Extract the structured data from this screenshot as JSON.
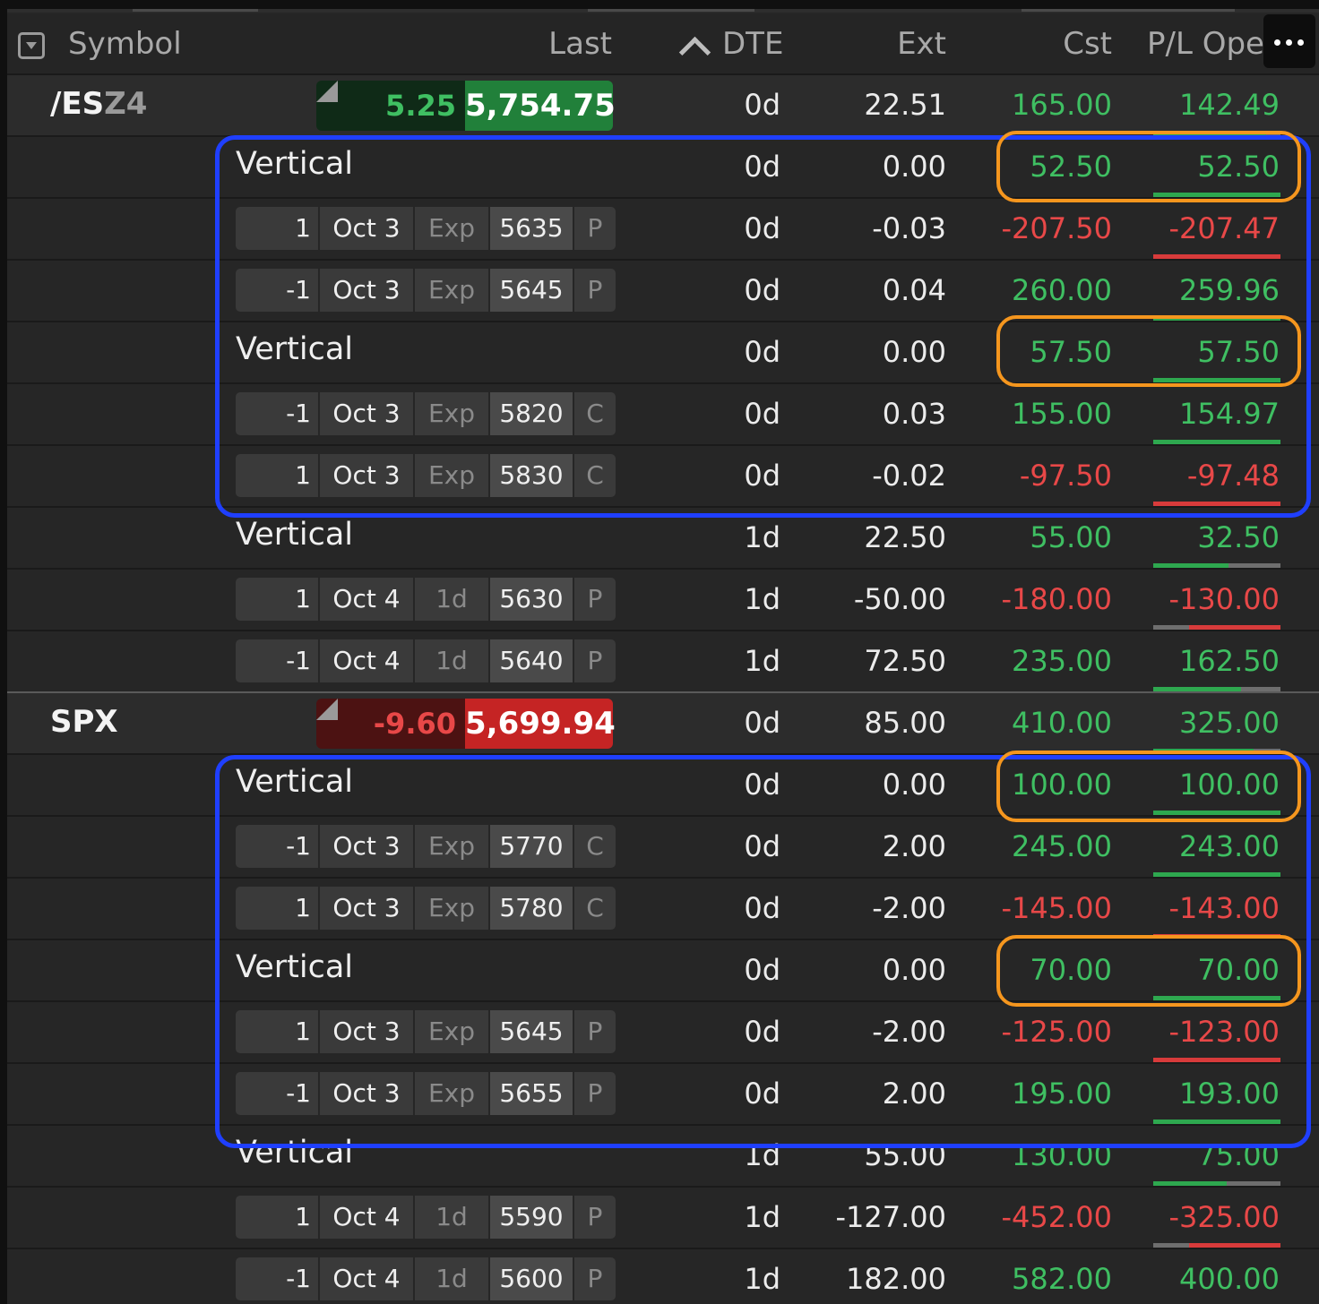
{
  "header": {
    "symbol": "Symbol",
    "last": "Last",
    "dte": "DTE",
    "ext": "Ext",
    "cst": "Cst",
    "pl": "P/L Open",
    "menu_icon": "ellipsis-icon",
    "sort_icon": "chevron-up-icon",
    "dropdown_icon": "dropdown-square-icon"
  },
  "colors": {
    "positive": "#3fbf62",
    "negative": "#e84848",
    "annotation_blue": "#1f3fff",
    "annotation_orange": "#f5961e"
  },
  "groups": [
    {
      "symbol_main": "/ES",
      "symbol_suffix": "Z4",
      "change": "5.25",
      "last": "5,754.75",
      "dte": "0d",
      "ext": "22.51",
      "cst": "165.00",
      "pl": "142.49",
      "pl_green_fraction": 0.89,
      "pl_red_fraction": 0
    },
    {
      "symbol_main": "SPX",
      "symbol_suffix": "",
      "change": "-9.60",
      "last": "5,699.94",
      "dte": "0d",
      "ext": "85.00",
      "cst": "410.00",
      "pl": "325.00",
      "pl_green_fraction": 0.79,
      "pl_red_fraction": 0
    }
  ],
  "rows": [
    {
      "kind": "strategy",
      "label": "Vertical",
      "dte": "0d",
      "ext": "0.00",
      "cst": "52.50",
      "pl": "52.50",
      "pl_green_fraction": 1.0,
      "pl_red_fraction": 0
    },
    {
      "kind": "leg",
      "qty": "1",
      "exp": "Oct 3",
      "dte_tag": "Exp",
      "strike": "5635",
      "type": "P",
      "dte": "0d",
      "ext": "-0.03",
      "cst": "-207.50",
      "pl": "-207.47",
      "pl_green_fraction": 0,
      "pl_red_fraction": 1.0
    },
    {
      "kind": "leg",
      "qty": "-1",
      "exp": "Oct 3",
      "dte_tag": "Exp",
      "strike": "5645",
      "type": "P",
      "dte": "0d",
      "ext": "0.04",
      "cst": "260.00",
      "pl": "259.96",
      "pl_green_fraction": 1.0,
      "pl_red_fraction": 0
    },
    {
      "kind": "strategy",
      "label": "Vertical",
      "dte": "0d",
      "ext": "0.00",
      "cst": "57.50",
      "pl": "57.50",
      "pl_green_fraction": 1.0,
      "pl_red_fraction": 0
    },
    {
      "kind": "leg",
      "qty": "-1",
      "exp": "Oct 3",
      "dte_tag": "Exp",
      "strike": "5820",
      "type": "C",
      "dte": "0d",
      "ext": "0.03",
      "cst": "155.00",
      "pl": "154.97",
      "pl_green_fraction": 1.0,
      "pl_red_fraction": 0
    },
    {
      "kind": "leg",
      "qty": "1",
      "exp": "Oct 3",
      "dte_tag": "Exp",
      "strike": "5830",
      "type": "C",
      "dte": "0d",
      "ext": "-0.02",
      "cst": "-97.50",
      "pl": "-97.48",
      "pl_green_fraction": 0,
      "pl_red_fraction": 1.0
    },
    {
      "kind": "strategy",
      "label": "Vertical",
      "dte": "1d",
      "ext": "22.50",
      "cst": "55.00",
      "pl": "32.50",
      "pl_green_fraction": 0.59,
      "pl_red_fraction": 0
    },
    {
      "kind": "leg",
      "qty": "1",
      "exp": "Oct 4",
      "dte_tag": "1d",
      "strike": "5630",
      "type": "P",
      "dte": "1d",
      "ext": "-50.00",
      "cst": "-180.00",
      "pl": "-130.00",
      "pl_green_fraction": 0,
      "pl_red_fraction": 0.72
    },
    {
      "kind": "leg",
      "qty": "-1",
      "exp": "Oct 4",
      "dte_tag": "1d",
      "strike": "5640",
      "type": "P",
      "dte": "1d",
      "ext": "72.50",
      "cst": "235.00",
      "pl": "162.50",
      "pl_green_fraction": 0.69,
      "pl_red_fraction": 0
    },
    {
      "kind": "group",
      "index": 1
    },
    {
      "kind": "strategy",
      "label": "Vertical",
      "dte": "0d",
      "ext": "0.00",
      "cst": "100.00",
      "pl": "100.00",
      "pl_green_fraction": 1.0,
      "pl_red_fraction": 0
    },
    {
      "kind": "leg",
      "qty": "-1",
      "exp": "Oct 3",
      "dte_tag": "Exp",
      "strike": "5770",
      "type": "C",
      "dte": "0d",
      "ext": "2.00",
      "cst": "245.00",
      "pl": "243.00",
      "pl_green_fraction": 1.0,
      "pl_red_fraction": 0
    },
    {
      "kind": "leg",
      "qty": "1",
      "exp": "Oct 3",
      "dte_tag": "Exp",
      "strike": "5780",
      "type": "C",
      "dte": "0d",
      "ext": "-2.00",
      "cst": "-145.00",
      "pl": "-143.00",
      "pl_green_fraction": 0,
      "pl_red_fraction": 1.0
    },
    {
      "kind": "strategy",
      "label": "Vertical",
      "dte": "0d",
      "ext": "0.00",
      "cst": "70.00",
      "pl": "70.00",
      "pl_green_fraction": 1.0,
      "pl_red_fraction": 0
    },
    {
      "kind": "leg",
      "qty": "1",
      "exp": "Oct 3",
      "dte_tag": "Exp",
      "strike": "5645",
      "type": "P",
      "dte": "0d",
      "ext": "-2.00",
      "cst": "-125.00",
      "pl": "-123.00",
      "pl_green_fraction": 0,
      "pl_red_fraction": 1.0
    },
    {
      "kind": "leg",
      "qty": "-1",
      "exp": "Oct 3",
      "dte_tag": "Exp",
      "strike": "5655",
      "type": "P",
      "dte": "0d",
      "ext": "2.00",
      "cst": "195.00",
      "pl": "193.00",
      "pl_green_fraction": 1.0,
      "pl_red_fraction": 0
    },
    {
      "kind": "strategy",
      "label": "Vertical",
      "dte": "1d",
      "ext": "55.00",
      "cst": "130.00",
      "pl": "75.00",
      "pl_green_fraction": 0.58,
      "pl_red_fraction": 0
    },
    {
      "kind": "leg",
      "qty": "1",
      "exp": "Oct 4",
      "dte_tag": "1d",
      "strike": "5590",
      "type": "P",
      "dte": "1d",
      "ext": "-127.00",
      "cst": "-452.00",
      "pl": "-325.00",
      "pl_green_fraction": 0,
      "pl_red_fraction": 0.72
    },
    {
      "kind": "leg",
      "qty": "-1",
      "exp": "Oct 4",
      "dte_tag": "1d",
      "strike": "5600",
      "type": "P",
      "dte": "1d",
      "ext": "182.00",
      "cst": "582.00",
      "pl": "400.00",
      "pl_green_fraction": 0.69,
      "pl_red_fraction": 0
    }
  ]
}
